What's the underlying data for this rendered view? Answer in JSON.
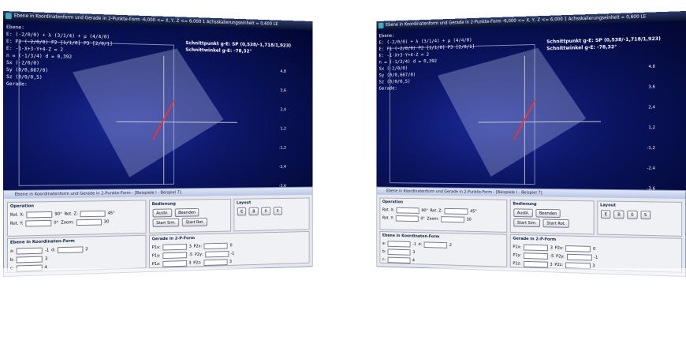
{
  "window": {
    "title": "Ebene in Koordinatenform und Gerade in 2-Punkte-Form   -6,000 <= X, Y, Z <= 6,000    1 Achsskalierungseinheit = 0,600 LE",
    "panel_title": "Ebene in Koordinatenform und Gerade in 2-Punkte-Form - [Beispiele I - Beispiel 7]"
  },
  "plot": {
    "side_lines": [
      "Ebene:",
      "E: (-2/0/0) + λ (3/1/4) + μ (4/4/0)",
      "E: P1 (-2/0/0)  P2 [1/1/0]  P3 [2/0/1]",
      "E: -1·X+3·Y+4·Z = 2",
      "n = (-1/3/4)   d = 0,392",
      "Sx (-2/0/0)",
      "Sy (0/0,667/0)",
      "Sz (0/0/0,5)",
      "Gerade:"
    ],
    "intersection": "Schnittpunkt g-E: SP (0,538/-1,718/1,923)",
    "angle": "Schnittwinkel g-E: -78,32°",
    "ticks": [
      "4,8",
      "3,6",
      "2,4",
      "1,2",
      "-1,2",
      "-2,4",
      "-3,6"
    ]
  },
  "operation": {
    "title": "Operation",
    "rotx_label": "Rot. X:",
    "rotx_val": "90°",
    "roty_label": "Rot. Y:",
    "roty_val": "0°",
    "rotz_label": "Rot. Z:",
    "rotz_val": "45°",
    "zoom_label": "Zoom:",
    "zoom_val": "30"
  },
  "ebene": {
    "title": "Ebene in Koordinaten-Form",
    "a_label": "a:",
    "a_val": "-1",
    "b_label": "b:",
    "b_val": "3",
    "c_label": "c:",
    "c_val": "4",
    "d_label": "d:",
    "d_val": "2"
  },
  "bedienung": {
    "title": "Bedienung",
    "ausbl": "Ausbl.",
    "beenden": "Beenden",
    "start_sim": "Start Sim.",
    "start_rot": "Start Rot."
  },
  "layout": {
    "title": "Layout",
    "b1": "E",
    "b2": "B",
    "b3": "0",
    "b4": "S"
  },
  "gerade": {
    "title": "Gerade in 2-P-Form",
    "p1x_label": "P1x:",
    "p1x_val": "3",
    "p1y_label": "P1y:",
    "p1y_val": "-5",
    "p1z_label": "P1z:",
    "p1z_val": "3",
    "p2x_label": "P2x:",
    "p2x_val": "0",
    "p2y_label": "P2y:",
    "p2y_val": "-1",
    "p2z_label": "P2z:",
    "p2z_val": "3"
  }
}
